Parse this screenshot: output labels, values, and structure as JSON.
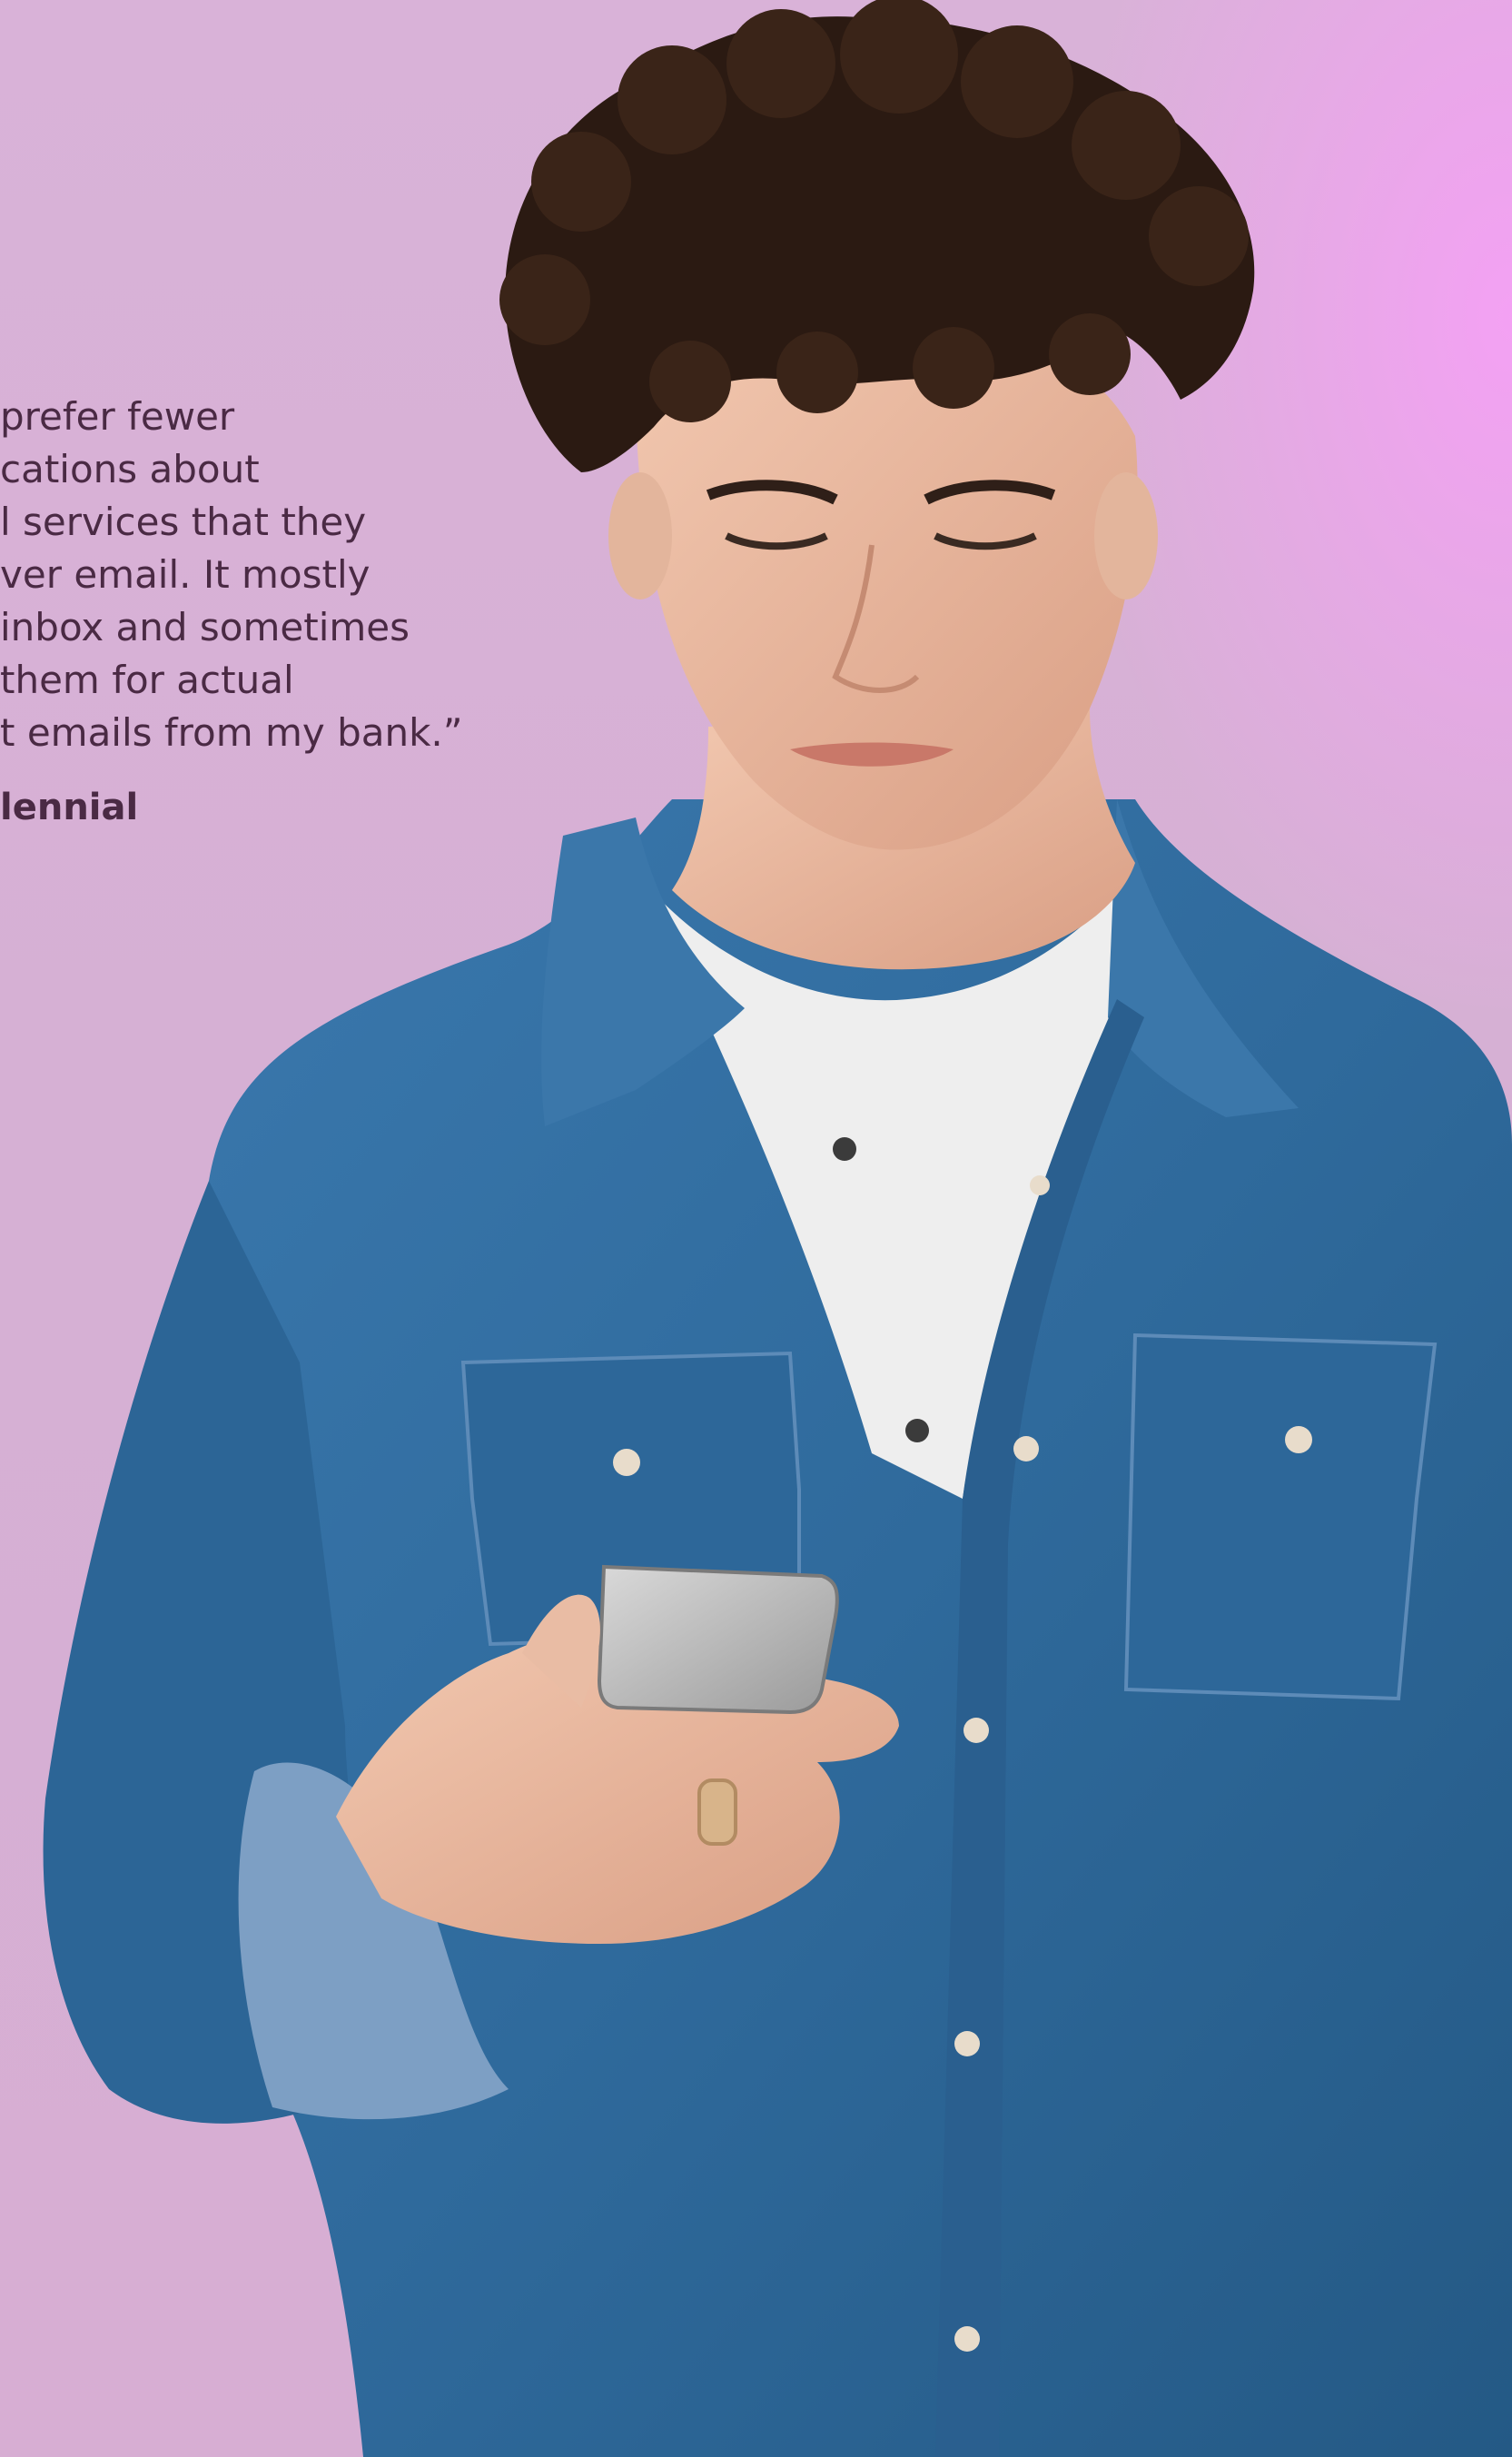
{
  "quote": {
    "lines": [
      "prefer fewer",
      "cations about",
      "l services that they",
      "ver email. It mostly",
      "inbox and sometimes",
      "them for actual",
      "t emails from my bank.”"
    ],
    "attribution": "lennial"
  },
  "colors": {
    "background": "#d8b1d5",
    "accent_glow": "#f5a0f5",
    "text": "#4a2a44",
    "shirt": "#2f6a9c"
  }
}
